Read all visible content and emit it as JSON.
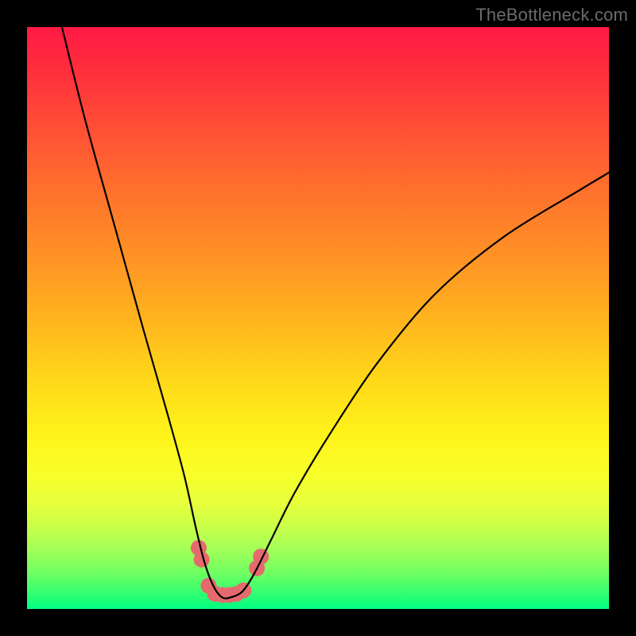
{
  "watermark": {
    "text": "TheBottleneck.com"
  },
  "chart_data": {
    "type": "line",
    "title": "",
    "xlabel": "",
    "ylabel": "",
    "xlim": [
      0,
      100
    ],
    "ylim": [
      0,
      100
    ],
    "series": [
      {
        "name": "bottleneck-curve",
        "x": [
          6,
          10,
          15,
          20,
          24,
          27,
          29,
          30.5,
          32,
          33.5,
          35,
          37,
          39,
          42,
          46,
          52,
          60,
          70,
          82,
          95,
          100
        ],
        "y": [
          100,
          84,
          66,
          48,
          34,
          23,
          14,
          8,
          4,
          2,
          2,
          3,
          6,
          12,
          20,
          30,
          42,
          54,
          64,
          72,
          75
        ]
      }
    ],
    "markers": {
      "name": "highlight-dots",
      "points": [
        {
          "x": 29.5,
          "y": 10.5
        },
        {
          "x": 30.0,
          "y": 8.5
        },
        {
          "x": 31.2,
          "y": 4.0
        },
        {
          "x": 32.3,
          "y": 2.6
        },
        {
          "x": 33.6,
          "y": 2.4
        },
        {
          "x": 34.8,
          "y": 2.4
        },
        {
          "x": 36.0,
          "y": 2.6
        },
        {
          "x": 37.2,
          "y": 3.2
        },
        {
          "x": 39.5,
          "y": 7.0
        },
        {
          "x": 40.2,
          "y": 9.0
        }
      ],
      "color": "#e46a6e",
      "radius_px": 10
    },
    "background_gradient": {
      "top": "#ff1a44",
      "mid1": "#ff8e26",
      "mid2": "#fff31a",
      "bottom": "#00ff84"
    }
  }
}
